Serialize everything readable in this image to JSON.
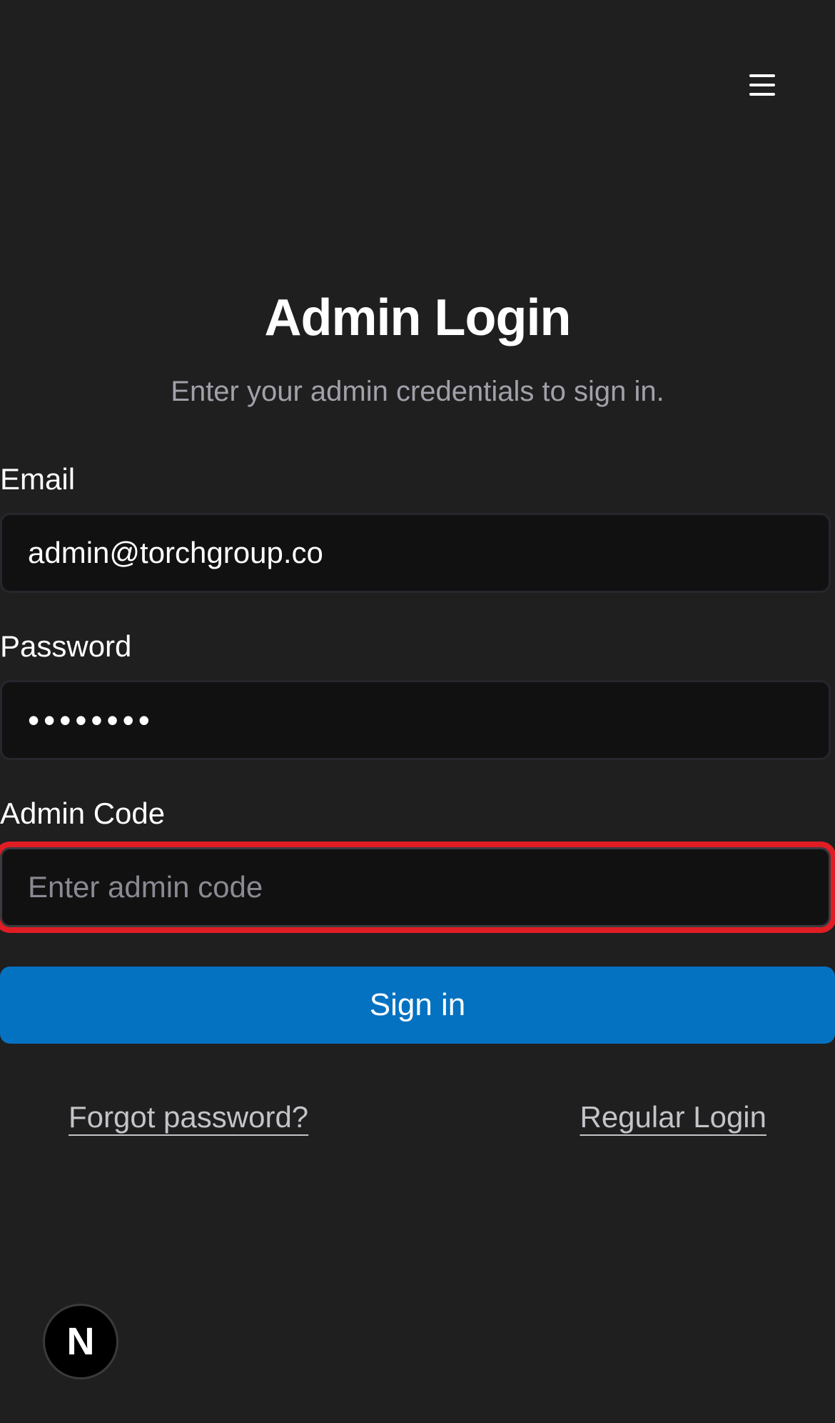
{
  "header": {
    "menu_icon": "hamburger-menu-icon"
  },
  "login": {
    "title": "Admin Login",
    "subtitle": "Enter your admin credentials to sign in.",
    "email": {
      "label": "Email",
      "value": "admin@torchgroup.co",
      "placeholder": ""
    },
    "password": {
      "label": "Password",
      "value": "••••••••"
    },
    "admin_code": {
      "label": "Admin Code",
      "value": "",
      "placeholder": "Enter admin code"
    },
    "signin_label": "Sign in",
    "forgot_password_label": "Forgot password?",
    "regular_login_label": "Regular Login"
  },
  "dev_badge": {
    "letter": "N"
  },
  "colors": {
    "background": "#1f1f20",
    "input_background": "#111112",
    "primary_button": "#0572c1",
    "focus_ring": "#e11d24",
    "muted_text": "#a1a1aa"
  }
}
